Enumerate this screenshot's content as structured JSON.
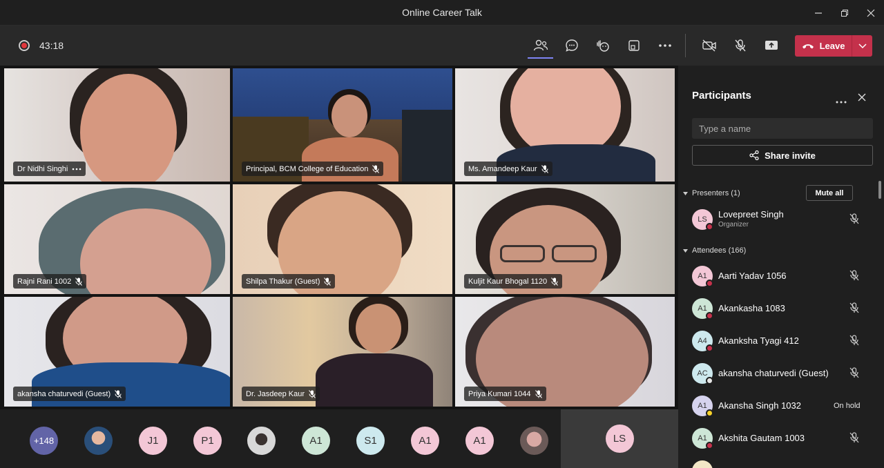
{
  "window": {
    "title": "Online Career Talk"
  },
  "toolbar": {
    "timer": "43:18",
    "leave_label": "Leave"
  },
  "tiles": [
    {
      "name": "Dr Nidhi Singhi",
      "icon": "more-icon"
    },
    {
      "name": "Principal, BCM College of Education",
      "icon": "mic-off-icon"
    },
    {
      "name": "Ms. Amandeep Kaur",
      "icon": "mic-off-icon"
    },
    {
      "name": "Rajni Rani 1002",
      "icon": "mic-off-icon"
    },
    {
      "name": "Shilpa Thakur (Guest)",
      "icon": "mic-off-icon"
    },
    {
      "name": "Kuljit Kaur Bhogal 1120",
      "icon": "mic-off-icon"
    },
    {
      "name": "akansha chaturvedi (Guest)",
      "icon": "mic-off-icon"
    },
    {
      "name": "Dr. Jasdeep Kaur",
      "icon": "mic-off-icon"
    },
    {
      "name": "Priya Kumari 1044",
      "icon": "mic-off-icon"
    }
  ],
  "strip": [
    {
      "label": "+148",
      "color": "#6264a7"
    },
    {
      "label": "",
      "color": "#3b6e8f"
    },
    {
      "label": "J1",
      "color": "#f3c7d6"
    },
    {
      "label": "P1",
      "color": "#f3c7d6"
    },
    {
      "label": "",
      "color": "#cfcfcf"
    },
    {
      "label": "A1",
      "color": "#cde6d6"
    },
    {
      "label": "S1",
      "color": "#cde9ee"
    },
    {
      "label": "A1",
      "color": "#f3c7d6"
    },
    {
      "label": "A1",
      "color": "#f3c7d6"
    },
    {
      "label": "",
      "color": "#d9a9a4"
    }
  ],
  "self": {
    "initials": "LS"
  },
  "panel": {
    "title": "Participants",
    "search_placeholder": "Type a name",
    "share_label": "Share invite",
    "presenters_label": "Presenters (1)",
    "mute_all_label": "Mute all",
    "attendees_label": "Attendees (166)",
    "presenters": [
      {
        "initials": "LS",
        "name": "Lovepreet Singh",
        "role": "Organizer",
        "avatar_color": "#f3c7d6",
        "status_color": "#c4314b"
      }
    ],
    "attendees": [
      {
        "initials": "A1",
        "name": "Aarti Yadav 1056",
        "avatar_color": "#f3c7d6",
        "status_color": "#c4314b",
        "state": "muted"
      },
      {
        "initials": "A1",
        "name": "Akankasha 1083",
        "avatar_color": "#cde6d6",
        "status_color": "#c4314b",
        "state": "muted"
      },
      {
        "initials": "A4",
        "name": "Akanksha Tyagi 412",
        "avatar_color": "#cde9ee",
        "status_color": "#c4314b",
        "state": "muted"
      },
      {
        "initials": "AC",
        "name": "akansha chaturvedi (Guest)",
        "avatar_color": "#cde9ee",
        "status_color": "#e6e6e6",
        "state": "muted"
      },
      {
        "initials": "A1",
        "name": "Akansha Singh 1032",
        "avatar_color": "#d6d3ee",
        "status_color": "#f8d22a",
        "state": "On hold"
      },
      {
        "initials": "A1",
        "name": "Akshita Gautam 1003",
        "avatar_color": "#cde6d6",
        "status_color": "#c4314b",
        "state": "muted"
      }
    ]
  }
}
